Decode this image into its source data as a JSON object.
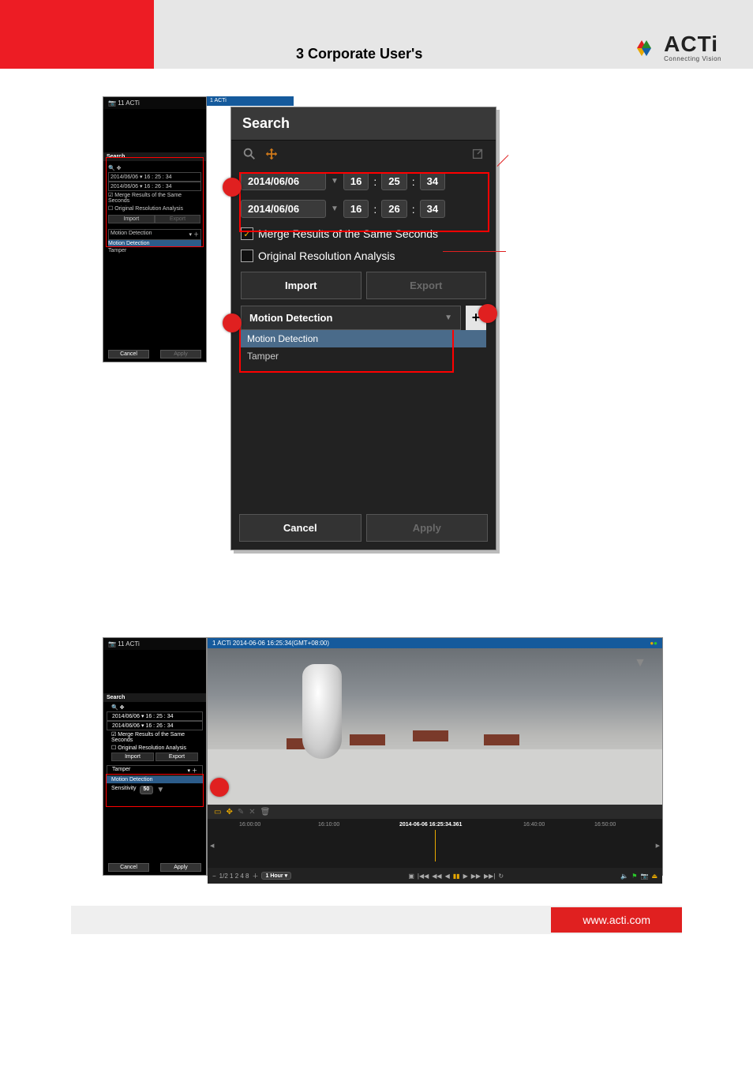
{
  "header": {
    "page_title": "3 Corporate User's",
    "logo_word": "ACTi",
    "logo_sub": "Connecting Vision"
  },
  "footer": {
    "url": "www.acti.com"
  },
  "panel_title": "Search",
  "small_window_title": "11 ACTi",
  "tab_label_small": "1 ACTi",
  "date_from": "2014/06/06",
  "date_to": "2014/06/06",
  "time_from": {
    "h": "16",
    "m": "25",
    "s": "34"
  },
  "time_to": {
    "h": "16",
    "m": "26",
    "s": "34"
  },
  "merge_label": "Merge Results of the Same Seconds",
  "orig_res_label": "Original Resolution Analysis",
  "import_label": "Import",
  "export_label": "Export",
  "event_select": "Motion Detection",
  "event_options": [
    "Motion Detection",
    "Tamper"
  ],
  "cancel_label": "Cancel",
  "apply_label": "Apply",
  "small_panel_rows": {
    "date1": "2014/06/06",
    "time1": "16  :  25  :  34",
    "date2": "2014/06/06",
    "time2": "16  :  26  :  34"
  },
  "shot2": {
    "tab_title": "1 ACTi  2014-06-06 16:25:34(GMT+08:00)",
    "sensitivity_label": "Sensitivity",
    "sensitivity_value": "50",
    "event_select": "Tamper",
    "added_event": "Motion Detection",
    "timeline": {
      "ticks": [
        "16:00:00",
        "16:10:00",
        "",
        "16:40:00",
        "16:50:00"
      ],
      "center": "2014-06-06 16:25:34.361",
      "zoom": "1 Hour",
      "speed_labels": "1/2   1   2   4   8"
    }
  }
}
